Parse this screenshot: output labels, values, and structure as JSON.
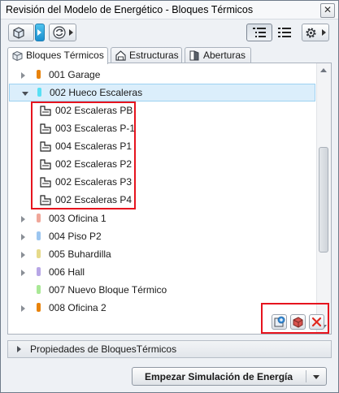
{
  "window": {
    "title": "Revisión del Modelo de Energético - Bloques Térmicos",
    "close_glyph": "✕"
  },
  "toolbar": {
    "left_buttons": [
      {
        "icon": "3d-model-icon"
      },
      {
        "icon": "refresh-icon"
      }
    ],
    "right_buttons": [
      {
        "icon": "tree-view-icon"
      },
      {
        "icon": "list-view-icon"
      },
      {
        "icon": "settings-gear-icon"
      }
    ]
  },
  "tabs": [
    {
      "label": "Bloques Térmicos",
      "icon": "blocks-icon",
      "active": true
    },
    {
      "label": "Estructuras",
      "icon": "house-icon",
      "active": false
    },
    {
      "label": "Aberturas",
      "icon": "door-icon",
      "active": false
    }
  ],
  "tree": {
    "rows": [
      {
        "label": "001 Garage",
        "color": "#e8830c",
        "expander": "collapsed"
      },
      {
        "label": "002 Hueco Escaleras",
        "color": "#59e0f4",
        "expander": "expanded",
        "selected": true
      },
      {
        "label": "002 Escaleras PB",
        "icon": "zone-icon"
      },
      {
        "label": "003 Escaleras P-1",
        "icon": "zone-icon"
      },
      {
        "label": "004 Escaleras P1",
        "icon": "zone-icon"
      },
      {
        "label": "002 Escaleras P2",
        "icon": "zone-icon"
      },
      {
        "label": "002 Escaleras P3",
        "icon": "zone-icon"
      },
      {
        "label": "002 Escaleras P4",
        "icon": "zone-icon"
      },
      {
        "label": "003 Oficina 1",
        "color": "#f0a79a",
        "expander": "collapsed"
      },
      {
        "label": "004 Piso P2",
        "color": "#9cc6f0",
        "expander": "collapsed"
      },
      {
        "label": "005 Buhardilla",
        "color": "#e6da8a",
        "expander": "collapsed"
      },
      {
        "label": "006 Hall",
        "color": "#b7a6e6",
        "expander": "collapsed"
      },
      {
        "label": "007 Nuevo Bloque Térmico",
        "color": "#a9e896",
        "expander": "none"
      },
      {
        "label": "008 Oficina 2",
        "color": "#e8830c",
        "expander": "collapsed"
      }
    ]
  },
  "actions": [
    {
      "icon": "add-block-icon"
    },
    {
      "icon": "assign-block-icon"
    },
    {
      "icon": "delete-icon"
    }
  ],
  "properties": {
    "label": "Propiedades de BloquesTérmicos"
  },
  "simulation": {
    "label": "Empezar Simulación de Energía"
  }
}
